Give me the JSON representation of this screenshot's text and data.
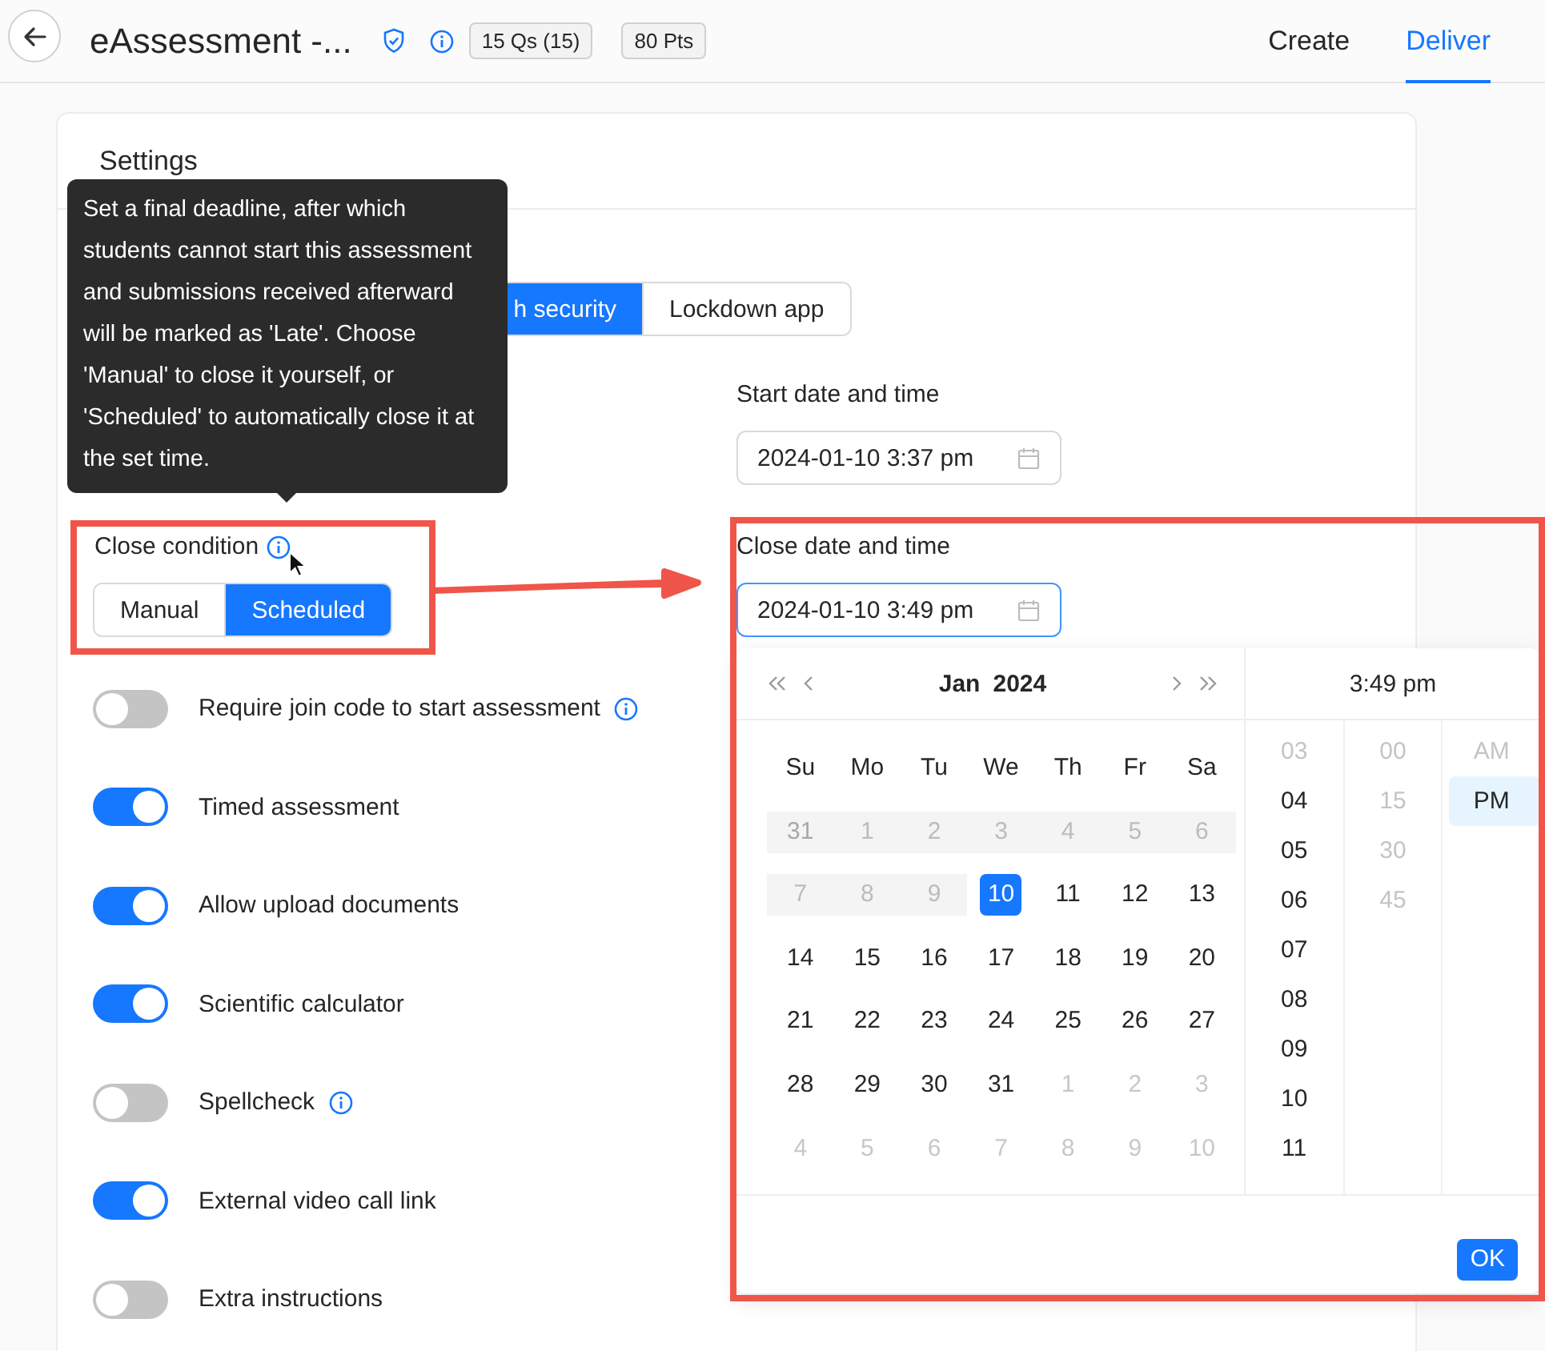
{
  "header": {
    "title": "eAssessment -...",
    "badges": [
      "15 Qs (15)",
      "80 Pts"
    ],
    "tabs": [
      {
        "label": "Create",
        "selected": false
      },
      {
        "label": "Deliver",
        "selected": true
      }
    ]
  },
  "settings": {
    "title": "Settings",
    "browser_options": [
      {
        "label": "h security",
        "selected": true
      },
      {
        "label": "Lockdown app",
        "selected": false
      }
    ],
    "start_datetime": {
      "label": "Start date and time",
      "value": "2024-01-10 3:37 pm"
    },
    "close_condition": {
      "label": "Close condition",
      "options": [
        {
          "label": "Manual",
          "selected": false
        },
        {
          "label": "Scheduled",
          "selected": true
        }
      ]
    },
    "close_datetime": {
      "label": "Close date and time",
      "value": "2024-01-10 3:49 pm"
    },
    "toggles": [
      {
        "label": "Require join code to start assessment",
        "on": false,
        "info": true
      },
      {
        "label": "Timed assessment",
        "on": true,
        "info": false
      },
      {
        "label": "Allow upload documents",
        "on": true,
        "info": false
      },
      {
        "label": "Scientific calculator",
        "on": true,
        "info": false
      },
      {
        "label": "Spellcheck",
        "on": false,
        "info": true
      },
      {
        "label": "External video call link",
        "on": true,
        "info": false
      },
      {
        "label": "Extra instructions",
        "on": false,
        "info": false
      }
    ]
  },
  "tooltip": {
    "text": "Set a final deadline, after which students cannot start this assessment and submissions received afterward will be marked as 'Late'. Choose 'Manual' to close it yourself, or 'Scheduled' to automatically close it at the set time."
  },
  "date_picker": {
    "month": "Jan",
    "year": "2024",
    "weekdays": [
      "Su",
      "Mo",
      "Tu",
      "We",
      "Th",
      "Fr",
      "Sa"
    ],
    "days": [
      {
        "label": "31",
        "in_month": false,
        "disabled": true,
        "selected": false
      },
      {
        "label": "1",
        "in_month": true,
        "disabled": true,
        "selected": false
      },
      {
        "label": "2",
        "in_month": true,
        "disabled": true,
        "selected": false
      },
      {
        "label": "3",
        "in_month": true,
        "disabled": true,
        "selected": false
      },
      {
        "label": "4",
        "in_month": true,
        "disabled": true,
        "selected": false
      },
      {
        "label": "5",
        "in_month": true,
        "disabled": true,
        "selected": false
      },
      {
        "label": "6",
        "in_month": true,
        "disabled": true,
        "selected": false
      },
      {
        "label": "7",
        "in_month": true,
        "disabled": true,
        "selected": false
      },
      {
        "label": "8",
        "in_month": true,
        "disabled": true,
        "selected": false
      },
      {
        "label": "9",
        "in_month": true,
        "disabled": true,
        "selected": false
      },
      {
        "label": "10",
        "in_month": true,
        "disabled": false,
        "selected": true
      },
      {
        "label": "11",
        "in_month": true,
        "disabled": false,
        "selected": false
      },
      {
        "label": "12",
        "in_month": true,
        "disabled": false,
        "selected": false
      },
      {
        "label": "13",
        "in_month": true,
        "disabled": false,
        "selected": false
      },
      {
        "label": "14",
        "in_month": true,
        "disabled": false,
        "selected": false
      },
      {
        "label": "15",
        "in_month": true,
        "disabled": false,
        "selected": false
      },
      {
        "label": "16",
        "in_month": true,
        "disabled": false,
        "selected": false
      },
      {
        "label": "17",
        "in_month": true,
        "disabled": false,
        "selected": false
      },
      {
        "label": "18",
        "in_month": true,
        "disabled": false,
        "selected": false
      },
      {
        "label": "19",
        "in_month": true,
        "disabled": false,
        "selected": false
      },
      {
        "label": "20",
        "in_month": true,
        "disabled": false,
        "selected": false
      },
      {
        "label": "21",
        "in_month": true,
        "disabled": false,
        "selected": false
      },
      {
        "label": "22",
        "in_month": true,
        "disabled": false,
        "selected": false
      },
      {
        "label": "23",
        "in_month": true,
        "disabled": false,
        "selected": false
      },
      {
        "label": "24",
        "in_month": true,
        "disabled": false,
        "selected": false
      },
      {
        "label": "25",
        "in_month": true,
        "disabled": false,
        "selected": false
      },
      {
        "label": "26",
        "in_month": true,
        "disabled": false,
        "selected": false
      },
      {
        "label": "27",
        "in_month": true,
        "disabled": false,
        "selected": false
      },
      {
        "label": "28",
        "in_month": true,
        "disabled": false,
        "selected": false
      },
      {
        "label": "29",
        "in_month": true,
        "disabled": false,
        "selected": false
      },
      {
        "label": "30",
        "in_month": true,
        "disabled": false,
        "selected": false
      },
      {
        "label": "31",
        "in_month": true,
        "disabled": false,
        "selected": false
      },
      {
        "label": "1",
        "in_month": false,
        "disabled": false,
        "selected": false
      },
      {
        "label": "2",
        "in_month": false,
        "disabled": false,
        "selected": false
      },
      {
        "label": "3",
        "in_month": false,
        "disabled": false,
        "selected": false
      },
      {
        "label": "4",
        "in_month": false,
        "disabled": false,
        "selected": false
      },
      {
        "label": "5",
        "in_month": false,
        "disabled": false,
        "selected": false
      },
      {
        "label": "6",
        "in_month": false,
        "disabled": false,
        "selected": false
      },
      {
        "label": "7",
        "in_month": false,
        "disabled": false,
        "selected": false
      },
      {
        "label": "8",
        "in_month": false,
        "disabled": false,
        "selected": false
      },
      {
        "label": "9",
        "in_month": false,
        "disabled": false,
        "selected": false
      },
      {
        "label": "10",
        "in_month": false,
        "disabled": false,
        "selected": false
      }
    ],
    "time_display": "3:49 pm",
    "hours": [
      {
        "label": "03",
        "disabled": true,
        "selected": false
      },
      {
        "label": "04",
        "disabled": false,
        "selected": false
      },
      {
        "label": "05",
        "disabled": false,
        "selected": false
      },
      {
        "label": "06",
        "disabled": false,
        "selected": false
      },
      {
        "label": "07",
        "disabled": false,
        "selected": false
      },
      {
        "label": "08",
        "disabled": false,
        "selected": false
      },
      {
        "label": "09",
        "disabled": false,
        "selected": false
      },
      {
        "label": "10",
        "disabled": false,
        "selected": false
      },
      {
        "label": "11",
        "disabled": false,
        "selected": false
      }
    ],
    "minutes": [
      {
        "label": "00",
        "disabled": true,
        "selected": false
      },
      {
        "label": "15",
        "disabled": true,
        "selected": false
      },
      {
        "label": "30",
        "disabled": true,
        "selected": false
      },
      {
        "label": "45",
        "disabled": true,
        "selected": false
      }
    ],
    "periods": [
      {
        "label": "AM",
        "disabled": true,
        "selected": false
      },
      {
        "label": "PM",
        "disabled": false,
        "selected": true
      }
    ],
    "ok_button": "OK"
  }
}
